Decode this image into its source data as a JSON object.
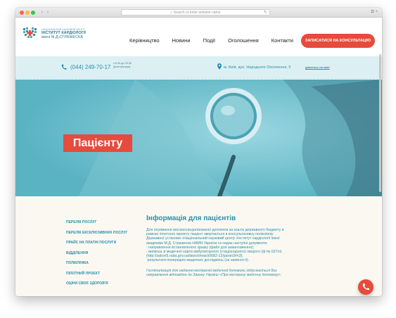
{
  "browser": {
    "url_placeholder": "Search or enter website name"
  },
  "logo": {
    "small": "НАЦІОНАЛЬНИЙ НАУКОВИЙ ЦЕНТР",
    "main": "ІНСТИТУТ КАРДІОЛОГІЇ",
    "sub": "імені М.Д.СТРАЖЕСКА"
  },
  "nav": {
    "items": [
      "Керівництво",
      "Новини",
      "Події",
      "Оголошення",
      "Контакти"
    ],
    "cta": "ЗАПИСАТИСЯ НА КОНСУЛЬТАЦІЮ"
  },
  "infobar": {
    "phone": "(044) 249-70-17",
    "hours_line1": "з 9.00 до 15.30",
    "hours_line2": "(реєстратура)",
    "address": "м. Київ, вул. Народного Ополчення, 5",
    "map_link": "дивитись на мапі"
  },
  "hero": {
    "title": "Пацієнту"
  },
  "sidebar": {
    "items": [
      "ПЕРЕЛІК ПОСЛУГ",
      "ПЕРЕЛІК ЕКСКЛЮЗИВНИХ ПОСЛУГ",
      "ПРАЙС НА ПЛАТНІ ПОСЛУГИ",
      "ВІДДІЛЕННЯ",
      "ПОЛІКЛІНІКА",
      "ПІЛОТНИЙ ПРОЕКТ",
      "ОЦІНИ СВОЄ ЗДОРОВ'Я"
    ]
  },
  "article": {
    "title": "Інформація для пацієнтів",
    "lines": [
      "Для отримання високоспеціалізованої допомоги за кошти державного бюджету в",
      "рамках пілотного проекту пацієнт звертається в консультативну поліклініку",
      "Державної установи «Національний науковий центр «Інститут кардіології імені",
      "академіка М.Д. Стражеска НАМН України та надає наступні документи:",
      "- направлення встановленого зразку (файл для завантаження);",
      "- виписка зі медичної карти амбулаторного (стаціонарного) хворого (ф № 027/о)",
      "(http://zakon5.rada.gov.ua/laws/show/z0682-12/paran3#n3);",
      "-результати попередніх медичних досліджень (за наявності)."
    ],
    "italic_lines": [
      "Госпіталізація для надання екстреної медичної допомоги здійснюється без",
      "направлення відповідно до Закону України «Про екстрену медичну допомогу»."
    ]
  },
  "colors": {
    "accent": "#e64b3c",
    "brand": "#2a8fa9",
    "hero": "#62b9c8"
  }
}
